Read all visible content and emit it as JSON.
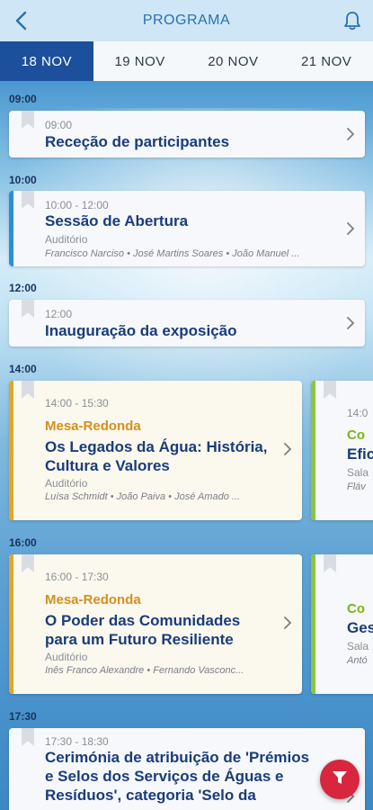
{
  "header": {
    "title": "PROGRAMA",
    "back_icon": "chevron-left-icon",
    "notif_icon": "bell-icon"
  },
  "tabs": [
    {
      "label": "18 NOV",
      "active": true
    },
    {
      "label": "19 NOV",
      "active": false
    },
    {
      "label": "20 NOV",
      "active": false
    },
    {
      "label": "21 NOV",
      "active": false
    }
  ],
  "times": [
    "09:00",
    "10:00",
    "12:00",
    "14:00",
    "16:00",
    "17:30"
  ],
  "sessions": [
    {
      "time": "09:00",
      "title": "Receção de participantes"
    },
    {
      "time": "10:00 - 12:00",
      "title": "Sessão de Abertura",
      "location": "Auditório",
      "people": [
        "Francisco Narciso",
        "José Martins Soares",
        "João Manuel ..."
      ]
    },
    {
      "time": "12:00",
      "title": "Inauguração da exposição"
    },
    {
      "time": "14:00 - 15:30",
      "kind": "Mesa-Redonda",
      "title_lines": [
        "Os Legados da Água: História,",
        "Cultura e Valores"
      ],
      "location": "Auditório",
      "people": [
        "Luísa Schmidt",
        "João Paiva",
        "José Amado ..."
      ]
    },
    {
      "time": "16:00 - 17:30",
      "kind": "Mesa-Redonda",
      "title_lines": [
        "O Poder das Comunidades",
        "para um Futuro Resiliente"
      ],
      "location": "Auditório",
      "people": [
        "Inês Franco Alexandre",
        "Fernando Vasconc..."
      ]
    },
    {
      "time": "17:30 - 18:30",
      "title_lines": [
        "Cerimónia de atribuição de 'Prémios",
        "e Selos dos Serviços de Águas e",
        "Resíduos', categoria 'Selo da"
      ]
    }
  ],
  "peek_cards": [
    {
      "time": "14:0",
      "kind": "Co",
      "title": "Efic",
      "location": "Sala",
      "people": "Fláv"
    },
    {
      "time": "",
      "kind": "Co",
      "title": "Ges",
      "location": "Sala",
      "people": "Antó"
    }
  ],
  "colors": {
    "accent": "#1c4f9c",
    "stripe_blue": "#2a8fd6",
    "stripe_orange": "#e6a52a",
    "stripe_green": "#8cc63f",
    "fab": "#d7263d"
  },
  "fab_icon": "filter-icon"
}
